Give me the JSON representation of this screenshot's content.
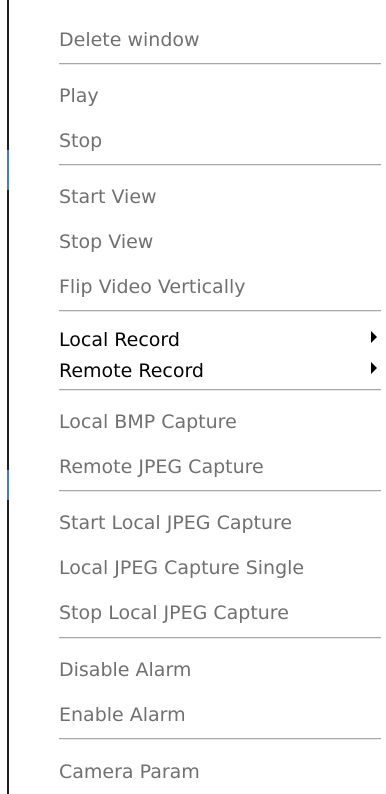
{
  "menu": {
    "items": [
      {
        "label": "Delete window"
      },
      {
        "label": "Play"
      },
      {
        "label": "Stop"
      },
      {
        "label": "Start View"
      },
      {
        "label": "Stop View"
      },
      {
        "label": "Flip Video Vertically"
      },
      {
        "label": "Local Record"
      },
      {
        "label": "Remote Record"
      },
      {
        "label": "Local BMP Capture"
      },
      {
        "label": "Remote JPEG Capture"
      },
      {
        "label": "Start Local JPEG Capture"
      },
      {
        "label": "Local JPEG Capture Single"
      },
      {
        "label": "Stop Local JPEG Capture"
      },
      {
        "label": "Disable Alarm"
      },
      {
        "label": "Enable Alarm"
      },
      {
        "label": "Camera Param"
      }
    ]
  }
}
